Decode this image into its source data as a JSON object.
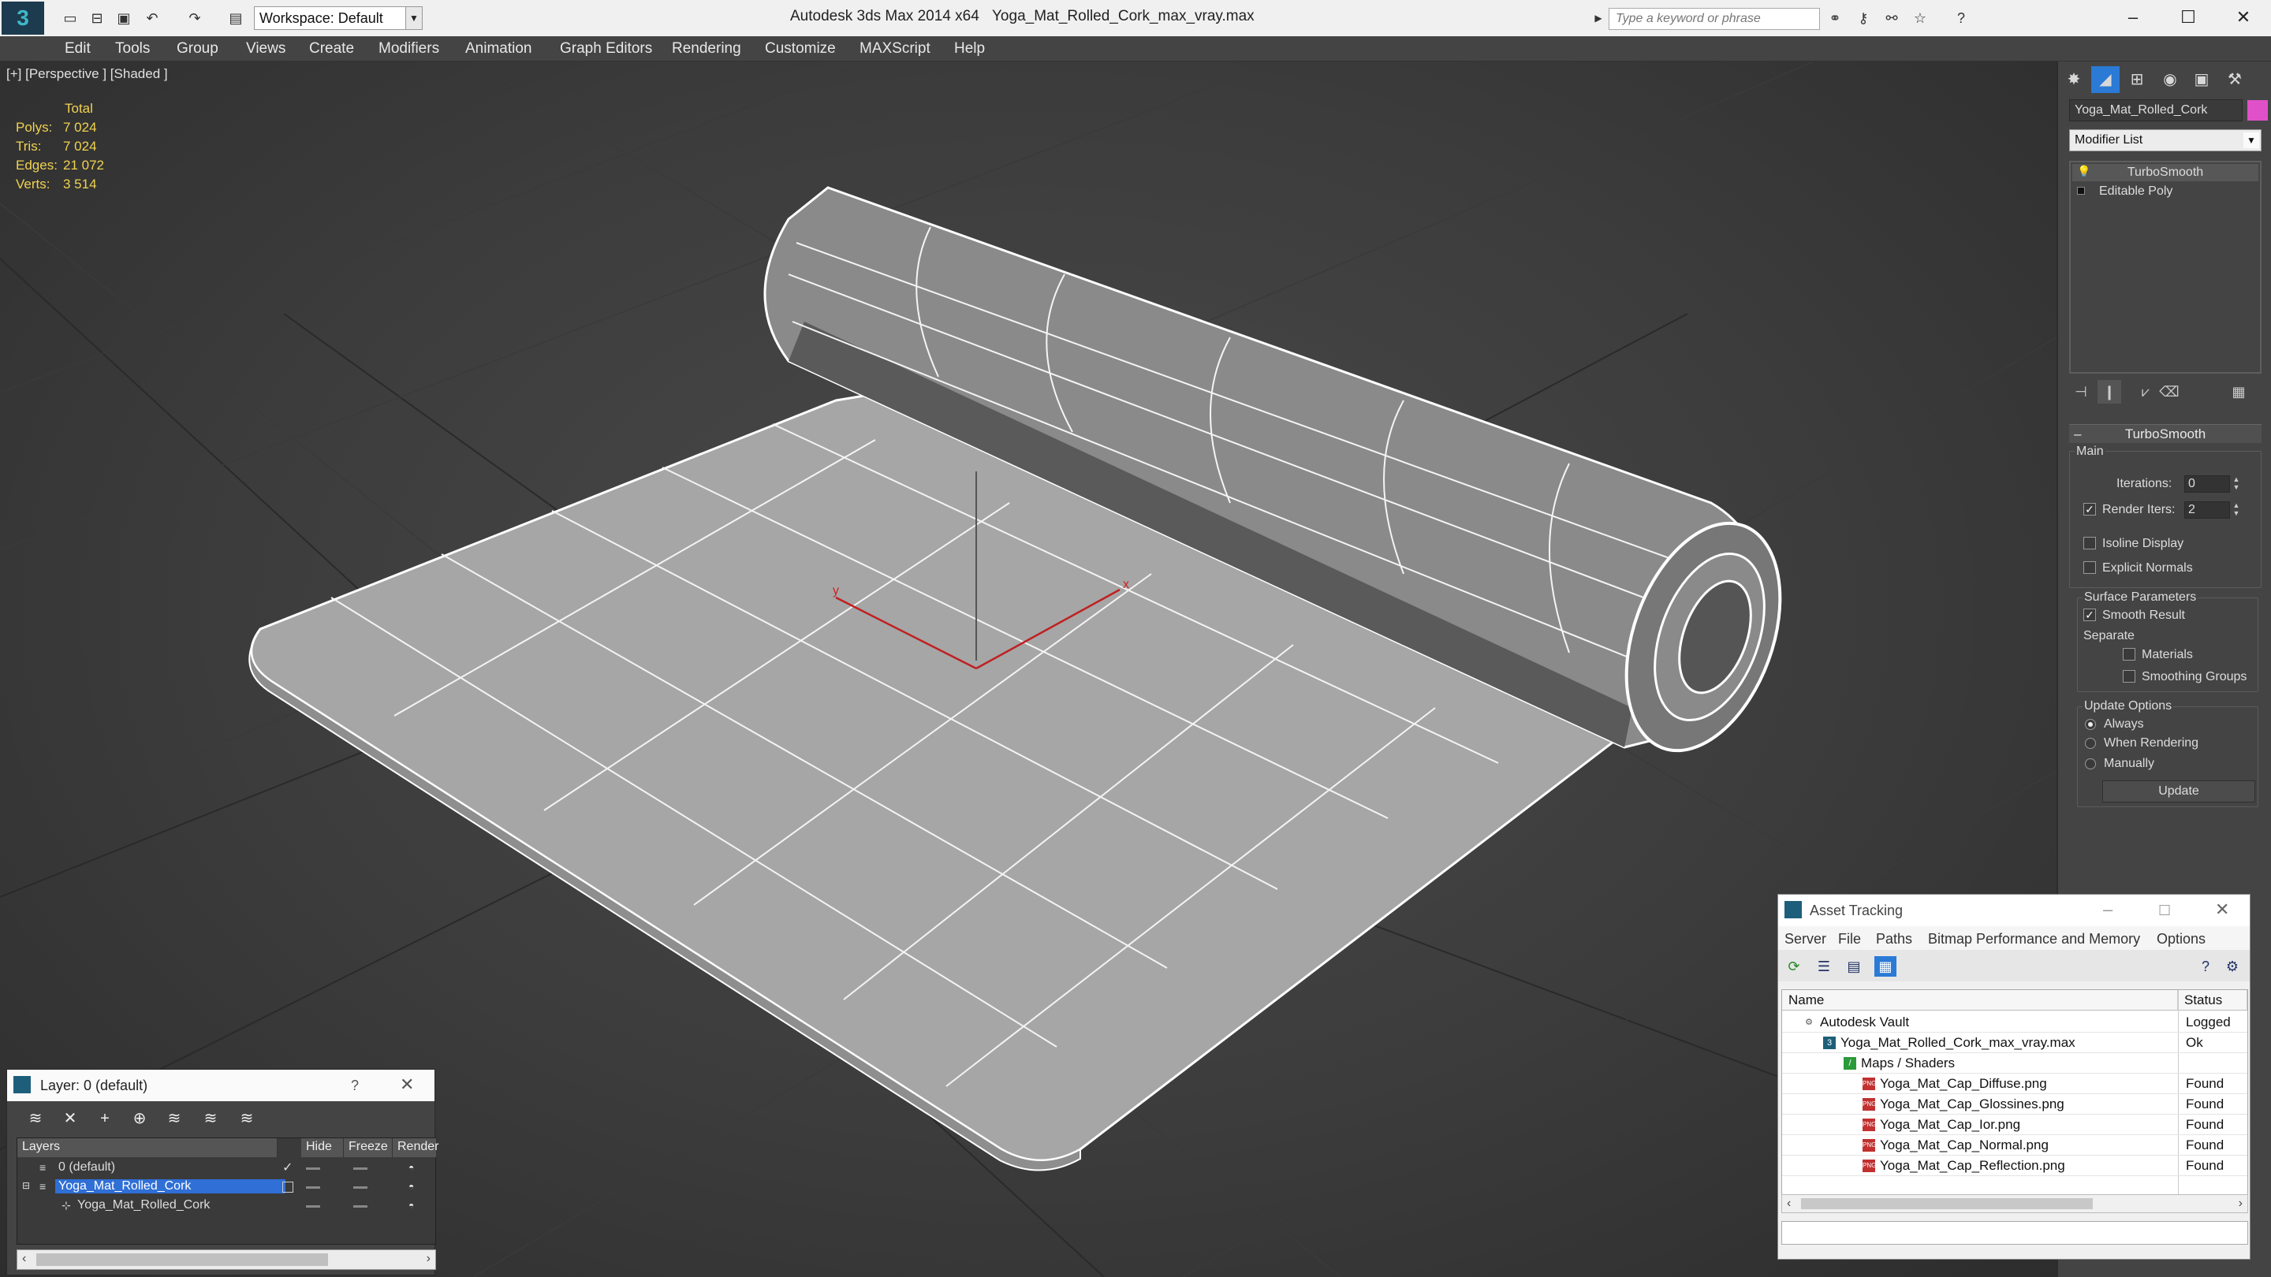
{
  "titlebar": {
    "app_title": "Autodesk 3ds Max  2014 x64",
    "file_title": "Yoga_Mat_Rolled_Cork_max_vray.max",
    "workspace": "Workspace: Default",
    "search_placeholder": "Type a keyword or phrase",
    "quick_access_icons": [
      "new-file-icon",
      "open-icon",
      "save-icon",
      "undo-icon",
      "redo-icon",
      "project-folder-icon"
    ],
    "search_tools": [
      "binoculars-icon",
      "key-icon",
      "communication-icon",
      "star-icon",
      "help-icon"
    ]
  },
  "menu": [
    "Edit",
    "Tools",
    "Group",
    "Views",
    "Create",
    "Modifiers",
    "Animation",
    "Graph Editors",
    "Rendering",
    "Customize",
    "MAXScript",
    "Help"
  ],
  "viewport": {
    "label": "[+] [Perspective ] [Shaded ]",
    "stats": {
      "header": "Total",
      "rows": [
        {
          "label": "Polys:",
          "value": "7 024"
        },
        {
          "label": "Tris:",
          "value": "7 024"
        },
        {
          "label": "Edges:",
          "value": "21 072"
        },
        {
          "label": "Verts:",
          "value": "3 514"
        }
      ]
    },
    "gizmo": {
      "x": "x",
      "y": "y"
    }
  },
  "command_panel": {
    "tabs": [
      "create-icon",
      "modify-icon",
      "hierarchy-icon",
      "motion-icon",
      "display-icon",
      "utilities-icon"
    ],
    "object_name": "Yoga_Mat_Rolled_Cork",
    "object_color": "#e050c8",
    "modifier_list": "Modifier List",
    "stack": [
      "TurboSmooth",
      "Editable Poly"
    ],
    "rollout": {
      "title": "TurboSmooth",
      "main": "Main",
      "iterations_label": "Iterations:",
      "iterations": "0",
      "render_iters_label": "Render Iters:",
      "render_iters": "2",
      "isoline": "Isoline Display",
      "explicit_normals": "Explicit Normals",
      "surface_params": "Surface Parameters",
      "smooth_result": "Smooth Result",
      "separate": "Separate",
      "materials": "Materials",
      "smoothing_groups": "Smoothing Groups",
      "update_options": "Update Options",
      "always": "Always",
      "when_rendering": "When Rendering",
      "manually": "Manually",
      "update_btn": "Update"
    }
  },
  "layer_dialog": {
    "title": "Layer: 0 (default)",
    "help": "?",
    "close": "✕",
    "columns": [
      "Layers",
      "Hide",
      "Freeze",
      "Render"
    ],
    "rows": [
      "0 (default)",
      "Yoga_Mat_Rolled_Cork",
      "Yoga_Mat_Rolled_Cork"
    ]
  },
  "asset_tracking": {
    "title": "Asset Tracking",
    "menu": [
      "Server",
      "File",
      "Paths",
      "Bitmap Performance and Memory",
      "Options"
    ],
    "columns": [
      "Name",
      "Status"
    ],
    "rows": [
      {
        "name": "Autodesk Vault",
        "status": "Logged"
      },
      {
        "name": "Yoga_Mat_Rolled_Cork_max_vray.max",
        "status": "Ok"
      },
      {
        "name": "Maps / Shaders",
        "status": ""
      },
      {
        "name": "Yoga_Mat_Cap_Diffuse.png",
        "status": "Found"
      },
      {
        "name": "Yoga_Mat_Cap_Glossines.png",
        "status": "Found"
      },
      {
        "name": "Yoga_Mat_Cap_Ior.png",
        "status": "Found"
      },
      {
        "name": "Yoga_Mat_Cap_Normal.png",
        "status": "Found"
      },
      {
        "name": "Yoga_Mat_Cap_Reflection.png",
        "status": "Found"
      }
    ]
  }
}
